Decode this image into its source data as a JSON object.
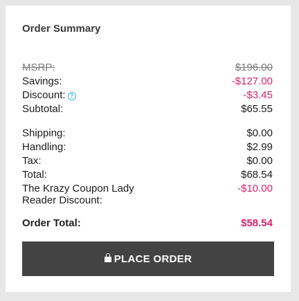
{
  "summary": {
    "title": "Order Summary",
    "msrp": {
      "label": "MSRP:",
      "value": "$196.00"
    },
    "savings": {
      "label": "Savings:",
      "value": "-$127.00"
    },
    "discount": {
      "label": "Discount:",
      "value": "-$3.45",
      "help_icon": "question-circle-icon"
    },
    "subtotal": {
      "label": "Subtotal:",
      "value": "$65.55"
    },
    "shipping": {
      "label": "Shipping:",
      "value": "$0.00"
    },
    "handling": {
      "label": "Handling:",
      "value": "$2.99"
    },
    "tax": {
      "label": "Tax:",
      "value": "$0.00"
    },
    "total": {
      "label": "Total:",
      "value": "$68.54"
    },
    "reader_discount": {
      "label_line1": "The Krazy Coupon Lady",
      "label_line2": "Reader Discount:",
      "value": "-$10.00"
    },
    "order_total": {
      "label": "Order Total:",
      "value": "$58.54"
    }
  },
  "actions": {
    "place_order_label": "PLACE ORDER",
    "lock_icon": "lock-icon"
  },
  "colors": {
    "accent_negative": "#d6226c",
    "help_icon": "#2ab6d6",
    "button_bg": "#434343",
    "page_bg": "#e7e7e7"
  }
}
